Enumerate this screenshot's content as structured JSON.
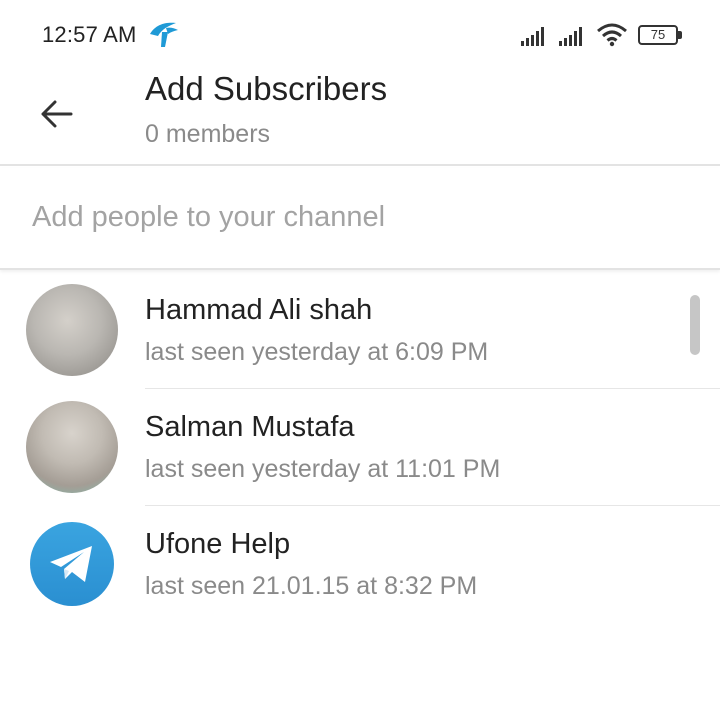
{
  "status_bar": {
    "time": "12:57 AM",
    "battery_level": "75",
    "icons": [
      "carrier-logo-icon",
      "signal-icon",
      "signal-icon",
      "wifi-icon",
      "battery-icon"
    ]
  },
  "header": {
    "title": "Add Subscribers",
    "subtitle": "0 members",
    "back_icon": "arrow-left-icon"
  },
  "search": {
    "placeholder": "Add people to your channel",
    "value": ""
  },
  "contacts": [
    {
      "name": "Hammad Ali shah",
      "status": "last seen yesterday at 6:09 PM",
      "avatar": "photo-blurred"
    },
    {
      "name": "Salman Mustafa",
      "status": "last seen yesterday at 11:01 PM",
      "avatar": "photo-blurred"
    },
    {
      "name": "Ufone Help",
      "status": "last seen 21.01.15 at 8:32 PM",
      "avatar": "telegram-logo-icon"
    }
  ],
  "colors": {
    "text_primary": "#222222",
    "text_secondary": "#8a8a8a",
    "placeholder": "#a3a3a3",
    "divider": "#e3e3e3",
    "telegram_blue": "#2a8fd1"
  }
}
